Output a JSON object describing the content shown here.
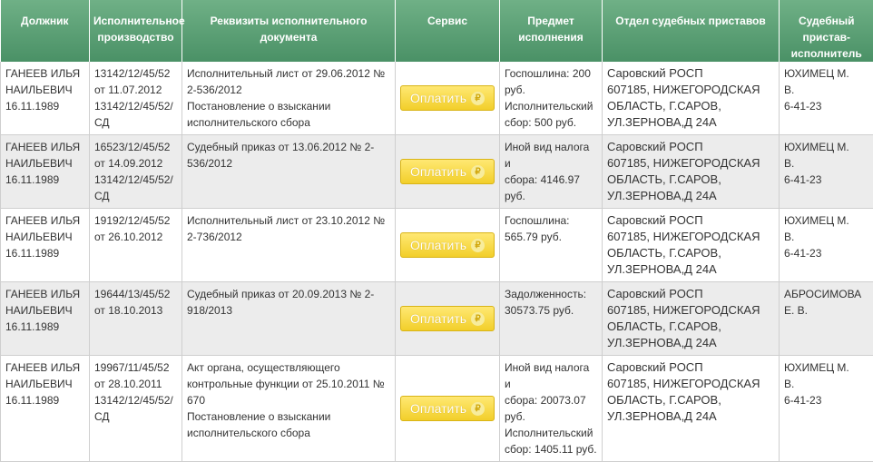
{
  "table": {
    "headers": {
      "debtor": "Должник",
      "proceeding": "Исполнительное производство",
      "document": "Реквизиты исполнительного документа",
      "service": "Сервис",
      "subject": "Предмет исполнения",
      "office": "Отдел судебных приставов",
      "bailiff": "Судебный пристав-исполнитель"
    },
    "pay_label": "Оплатить",
    "pay_icon": "ruble-icon",
    "rows": [
      {
        "debtor": [
          "ГАНЕЕВ ИЛЬЯ",
          "НАИЛЬЕВИЧ",
          "16.11.1989"
        ],
        "proceeding": [
          "13142/12/45/52",
          "от 11.07.2012",
          "13142/12/45/52/",
          "СД"
        ],
        "document": [
          "Исполнительный лист от 29.06.2012 №",
          "2-536/2012",
          "Постановление о взыскании",
          "исполнительского сбора"
        ],
        "subject": [
          "Госпошлина: 200",
          "руб.",
          "Исполнительский",
          "сбор: 500 руб."
        ],
        "office": [
          "Саровский РОСП",
          "607185, НИЖЕГОРОДСКАЯ",
          "ОБЛАСТЬ, Г.САРОВ,",
          "УЛ.ЗЕРНОВА,Д 24А"
        ],
        "bailiff": [
          "ЮХИМЕЦ М.",
          "В.",
          "6-41-23"
        ]
      },
      {
        "debtor": [
          "ГАНЕЕВ ИЛЬЯ",
          "НАИЛЬЕВИЧ",
          "16.11.1989"
        ],
        "proceeding": [
          "16523/12/45/52",
          "от 14.09.2012",
          "13142/12/45/52/",
          "СД"
        ],
        "document": [
          "Судебный приказ от 13.06.2012 № 2-",
          "536/2012"
        ],
        "subject": [
          "Иной вид налога и",
          "сбора: 4146.97",
          "руб."
        ],
        "office": [
          "Саровский РОСП",
          "607185, НИЖЕГОРОДСКАЯ",
          "ОБЛАСТЬ, Г.САРОВ,",
          "УЛ.ЗЕРНОВА,Д 24А"
        ],
        "bailiff": [
          "ЮХИМЕЦ М.",
          "В.",
          "6-41-23"
        ]
      },
      {
        "debtor": [
          "ГАНЕЕВ ИЛЬЯ",
          "НАИЛЬЕВИЧ",
          "16.11.1989"
        ],
        "proceeding": [
          "19192/12/45/52",
          "от 26.10.2012"
        ],
        "document": [
          "Исполнительный лист от 23.10.2012 №",
          "2-736/2012"
        ],
        "subject": [
          "Госпошлина:",
          "565.79 руб."
        ],
        "office": [
          "Саровский РОСП",
          "607185, НИЖЕГОРОДСКАЯ",
          "ОБЛАСТЬ, Г.САРОВ,",
          "УЛ.ЗЕРНОВА,Д 24А"
        ],
        "bailiff": [
          "ЮХИМЕЦ М.",
          "В.",
          "6-41-23"
        ]
      },
      {
        "debtor": [
          "ГАНЕЕВ ИЛЬЯ",
          "НАИЛЬЕВИЧ",
          "16.11.1989"
        ],
        "proceeding": [
          "19644/13/45/52",
          "от 18.10.2013"
        ],
        "document": [
          "Судебный приказ от 20.09.2013 № 2-",
          "918/2013"
        ],
        "subject": [
          "Задолженность:",
          "30573.75 руб."
        ],
        "office": [
          "Саровский РОСП",
          "607185, НИЖЕГОРОДСКАЯ",
          "ОБЛАСТЬ, Г.САРОВ,",
          "УЛ.ЗЕРНОВА,Д 24А"
        ],
        "bailiff": [
          "АБРОСИМОВА",
          "Е. В."
        ]
      },
      {
        "debtor": [
          "ГАНЕЕВ ИЛЬЯ",
          "НАИЛЬЕВИЧ",
          "16.11.1989"
        ],
        "proceeding": [
          "19967/11/45/52",
          "от 28.10.2011",
          "13142/12/45/52/",
          "СД"
        ],
        "document": [
          "Акт органа, осуществляющего",
          "контрольные функции от 25.10.2011 №",
          "670",
          "Постановление о взыскании",
          "исполнительского сбора"
        ],
        "subject": [
          "Иной вид налога и",
          "сбора: 20073.07",
          "руб.",
          "Исполнительский",
          "сбор: 1405.11 руб."
        ],
        "office": [
          "Саровский РОСП",
          "607185, НИЖЕГОРОДСКАЯ",
          "ОБЛАСТЬ, Г.САРОВ,",
          "УЛ.ЗЕРНОВА,Д 24А"
        ],
        "bailiff": [
          "ЮХИМЕЦ М.",
          "В.",
          "6-41-23"
        ]
      }
    ]
  }
}
